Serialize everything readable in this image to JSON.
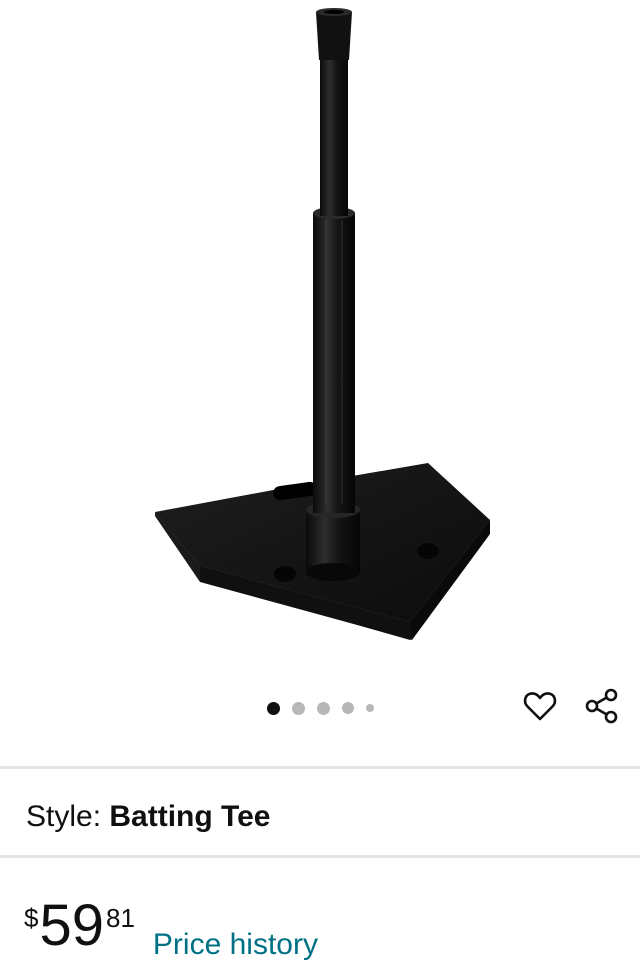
{
  "product": {
    "image_alt": "Batting Tee",
    "style_label": "Style: ",
    "style_value": "Batting Tee"
  },
  "carousel": {
    "dot_count": 5,
    "active_index": 0
  },
  "actions": {
    "wishlist_icon": "heart-outline-icon",
    "share_icon": "share-icon"
  },
  "price": {
    "currency_symbol": "$",
    "whole": "59",
    "fraction": "81",
    "history_link": "Price history"
  },
  "colors": {
    "link": "#007185",
    "text": "#0f1111",
    "divider": "#e3e6e6",
    "dot_inactive": "#b7b7b7",
    "dot_active": "#0f1111"
  }
}
